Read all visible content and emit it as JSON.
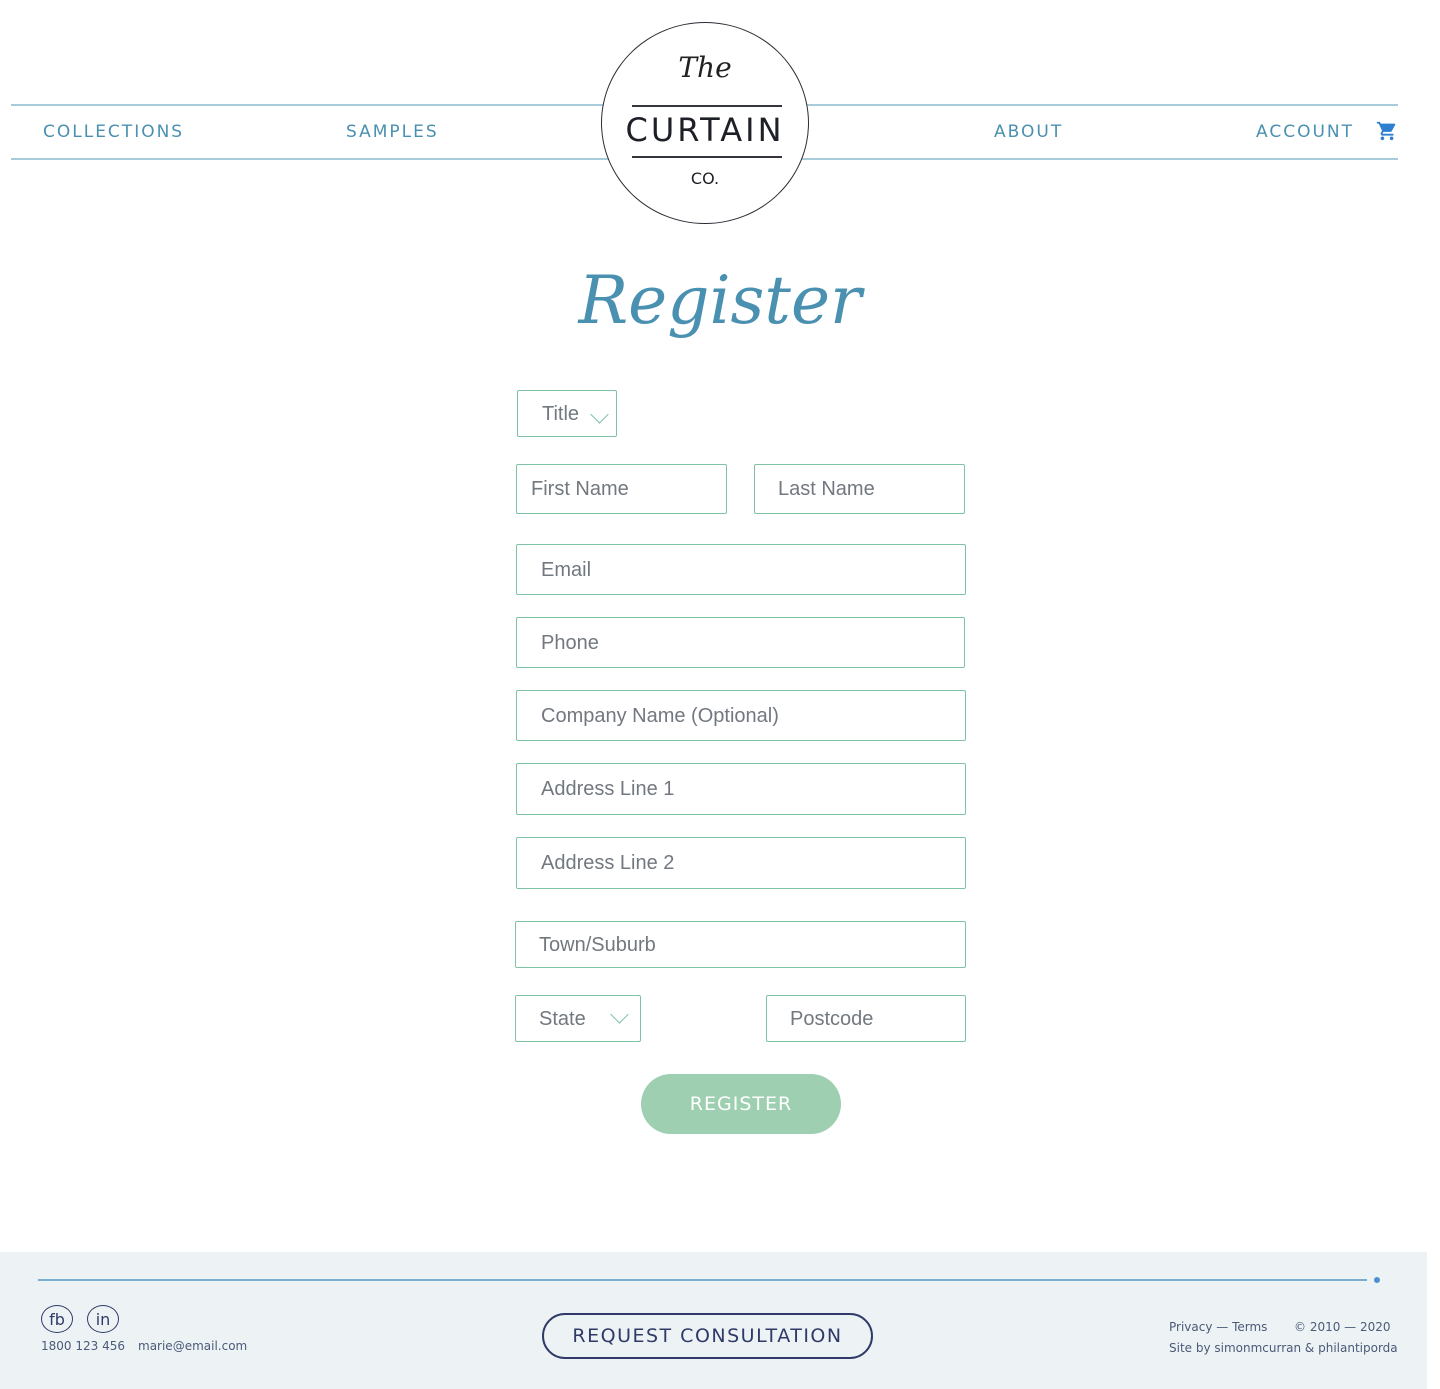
{
  "header": {
    "nav": {
      "collections": "COLLECTIONS",
      "samples": "SAMPLES",
      "about": "ABOUT",
      "account": "ACCOUNT"
    },
    "cart_icon": "cart-icon",
    "logo": {
      "the": "The",
      "name": "CURTAIN",
      "co": "CO."
    }
  },
  "page": {
    "heading": "Register"
  },
  "form": {
    "title_select": "Title",
    "first_name": "First Name",
    "last_name": "Last Name",
    "email": "Email",
    "phone": "Phone",
    "company": "Company Name (Optional)",
    "address1": "Address Line 1",
    "address2": "Address Line 2",
    "town": "Town/Suburb",
    "state_select": "State",
    "postcode": "Postcode",
    "submit": "REGISTER"
  },
  "footer": {
    "social": {
      "fb": "fb",
      "in": "in"
    },
    "phone": "1800 123 456",
    "email": "marie@email.com",
    "cta": "REQUEST CONSULTATION",
    "legal": "Privacy — Terms",
    "copyright": "© 2010 — 2020",
    "credit": "Site by simonmcurran & philantiporda"
  },
  "colors": {
    "accent_blue": "#4a90b0",
    "field_border": "#7fc2a4",
    "button_green": "#9dcfb0",
    "footer_bg": "#edf3f5",
    "navy": "#2f3a68"
  }
}
